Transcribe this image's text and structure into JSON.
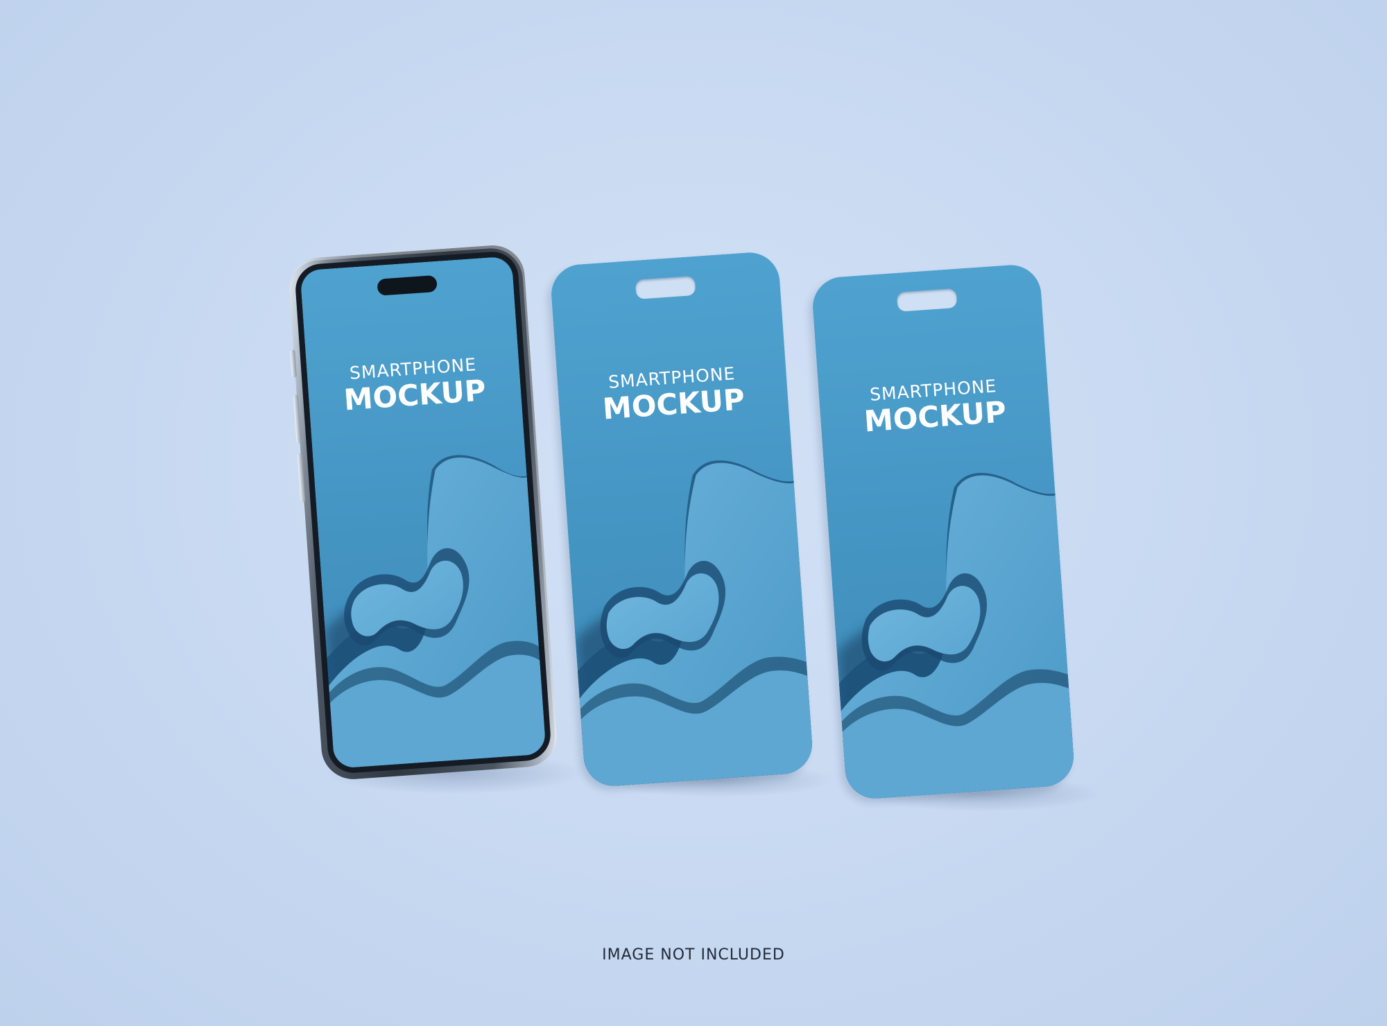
{
  "devices": [
    {
      "kind": "smartphone",
      "screen_line_1": "SMARTPHONE",
      "screen_line_2": "MOCKUP"
    },
    {
      "kind": "phone-case",
      "screen_line_1": "SMARTPHONE",
      "screen_line_2": "MOCKUP"
    },
    {
      "kind": "phone-case",
      "screen_line_1": "SMARTPHONE",
      "screen_line_2": "MOCKUP"
    }
  ],
  "caption": "IMAGE NOT INCLUDED",
  "colors": {
    "background": "#c9daf2",
    "screen_blue": "#4a9cc9",
    "text": "#ffffff",
    "caption_text": "#1f2a36"
  }
}
